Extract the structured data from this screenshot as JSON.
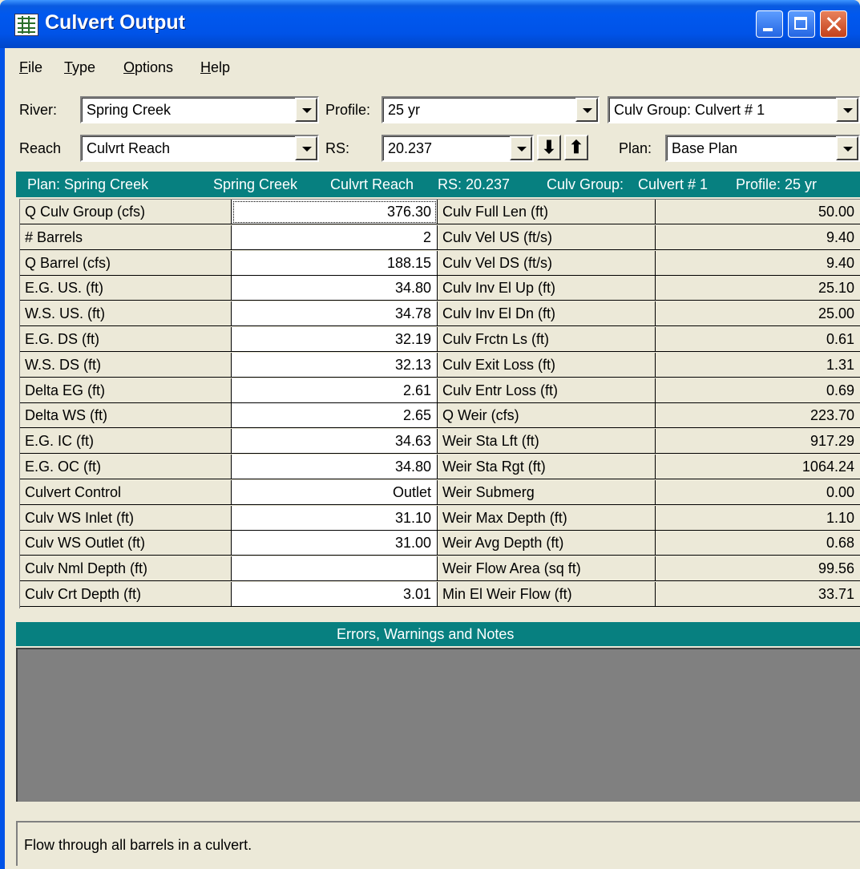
{
  "window": {
    "title": "Culvert Output"
  },
  "menu": [
    "File",
    "Type",
    "Options",
    "Help"
  ],
  "controls": {
    "river_label": "River:",
    "river_value": "Spring Creek",
    "profile_label": "Profile:",
    "profile_value": "25 yr",
    "culv_group_value": "Culv Group:  Culvert # 1",
    "reach_label": "Reach",
    "reach_value": "Culvrt Reach",
    "rs_label": "RS:",
    "rs_value": "20.237",
    "down_arrow": "⬇",
    "up_arrow": "⬆",
    "plan_label": "Plan:",
    "plan_value": "Base Plan"
  },
  "header": {
    "parts": [
      "Plan: Spring Creek",
      "Spring Creek",
      "Culvrt Reach",
      "RS: 20.237",
      "Culv Group:",
      "Culvert # 1",
      "Profile: 25 yr"
    ]
  },
  "table": {
    "rows": [
      {
        "l": "Q Culv Group (cfs)",
        "lv": "376.30",
        "r": "Culv Full Len (ft)",
        "rv": "50.00"
      },
      {
        "l": "# Barrels",
        "lv": "2",
        "r": "Culv Vel US (ft/s)",
        "rv": "9.40"
      },
      {
        "l": "Q Barrel (cfs)",
        "lv": "188.15",
        "r": "Culv Vel DS (ft/s)",
        "rv": "9.40"
      },
      {
        "l": "E.G. US. (ft)",
        "lv": "34.80",
        "r": "Culv Inv El Up (ft)",
        "rv": "25.10"
      },
      {
        "l": "W.S. US. (ft)",
        "lv": "34.78",
        "r": "Culv Inv El Dn (ft)",
        "rv": "25.00"
      },
      {
        "l": "E.G. DS (ft)",
        "lv": "32.19",
        "r": "Culv Frctn Ls (ft)",
        "rv": "0.61"
      },
      {
        "l": "W.S. DS (ft)",
        "lv": "32.13",
        "r": "Culv Exit Loss (ft)",
        "rv": "1.31"
      },
      {
        "l": "Delta EG (ft)",
        "lv": "2.61",
        "r": "Culv Entr Loss (ft)",
        "rv": "0.69"
      },
      {
        "l": "Delta WS (ft)",
        "lv": "2.65",
        "r": "Q Weir (cfs)",
        "rv": "223.70"
      },
      {
        "l": "E.G. IC (ft)",
        "lv": "34.63",
        "r": "Weir Sta Lft (ft)",
        "rv": "917.29"
      },
      {
        "l": "E.G. OC (ft)",
        "lv": "34.80",
        "r": "Weir Sta Rgt (ft)",
        "rv": "1064.24"
      },
      {
        "l": "Culvert Control",
        "lv": "Outlet",
        "r": "Weir Submerg",
        "rv": "0.00"
      },
      {
        "l": "Culv WS Inlet (ft)",
        "lv": "31.10",
        "r": "Weir Max Depth (ft)",
        "rv": "1.10"
      },
      {
        "l": "Culv WS Outlet (ft)",
        "lv": "31.00",
        "r": "Weir Avg Depth (ft)",
        "rv": "0.68"
      },
      {
        "l": "Culv Nml Depth (ft)",
        "lv": "",
        "r": "Weir Flow Area (sq ft)",
        "rv": "99.56"
      },
      {
        "l": "Culv Crt Depth (ft)",
        "lv": "3.01",
        "r": "Min El Weir Flow (ft)",
        "rv": "33.71"
      }
    ]
  },
  "errors": {
    "title": "Errors, Warnings and Notes"
  },
  "status": {
    "text": "Flow through all barrels in a culvert."
  }
}
